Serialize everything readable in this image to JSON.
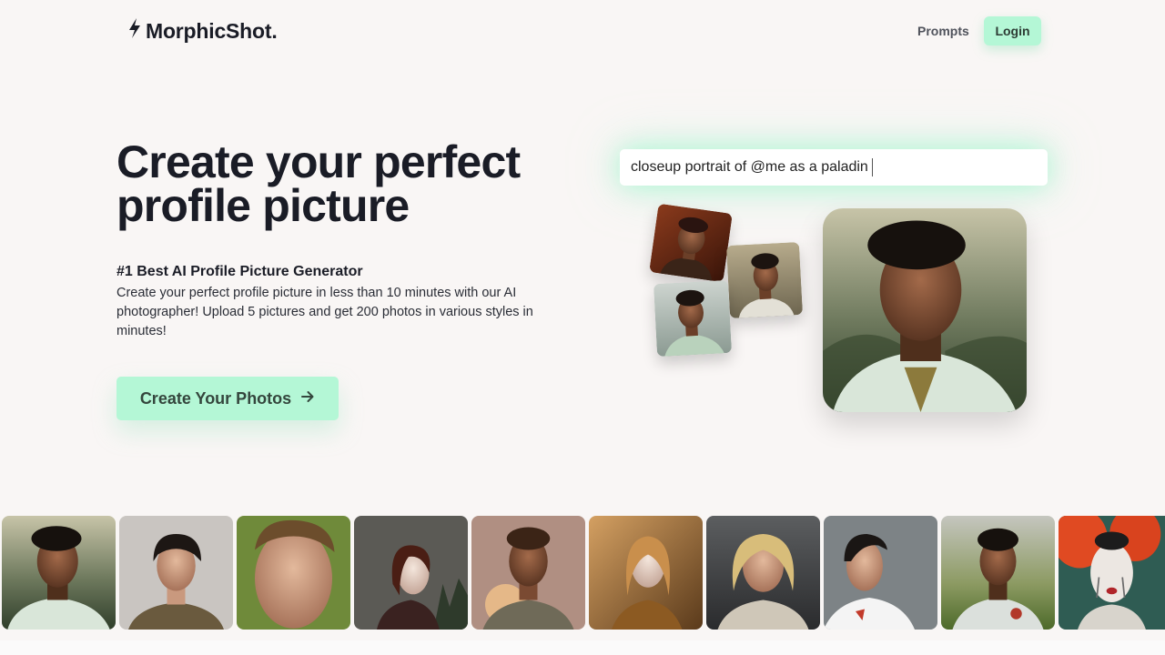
{
  "header": {
    "logo_text": "MorphicShot.",
    "logo_icon": "lightning-bolt-icon",
    "nav": {
      "prompts_label": "Prompts",
      "login_label": "Login"
    }
  },
  "hero": {
    "title_line1": "Create your perfect",
    "title_line2": "profile picture",
    "subtitle": "#1 Best AI Profile Picture Generator",
    "description": "Create your perfect profile picture in less than 10 minutes with our AI photographer! Upload 5 pictures and get 200 photos in various styles in minutes!",
    "cta_label": "Create Your Photos",
    "cta_icon": "arrow-right-icon"
  },
  "demo": {
    "prompt_text": "closeup portrait of @me as a paladin"
  },
  "colors": {
    "background": "#f9f6f5",
    "accent": "#b4f7d6",
    "text_dark": "#1a1c26"
  }
}
